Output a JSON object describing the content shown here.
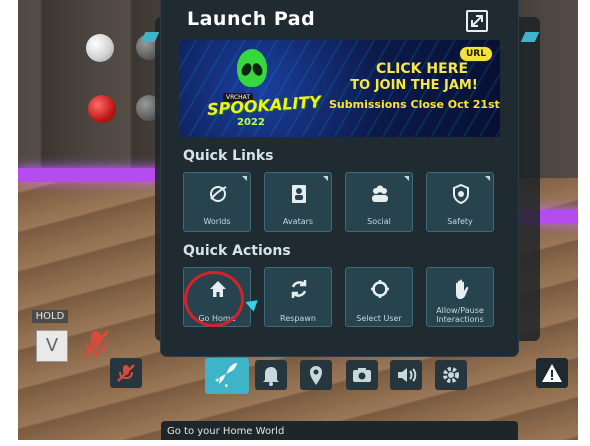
{
  "launch_pad": {
    "title": "Launch Pad"
  },
  "banner": {
    "brand_tag": "VRCHAT",
    "event_title": "SPOOKALITY",
    "event_year": "2022",
    "url_badge": "URL",
    "cta_line1": "CLICK HERE",
    "cta_line2": "TO JOIN THE JAM!",
    "deadline": "Submissions Close Oct 21st"
  },
  "quick_links": {
    "title": "Quick Links",
    "items": [
      {
        "label": "Worlds",
        "icon": "worlds-icon"
      },
      {
        "label": "Avatars",
        "icon": "avatars-icon"
      },
      {
        "label": "Social",
        "icon": "social-icon"
      },
      {
        "label": "Safety",
        "icon": "safety-icon"
      }
    ]
  },
  "quick_actions": {
    "title": "Quick Actions",
    "items": [
      {
        "label": "Go Home",
        "icon": "home-icon"
      },
      {
        "label": "Respawn",
        "icon": "respawn-icon"
      },
      {
        "label": "Select User",
        "icon": "crosshair-icon"
      },
      {
        "label": "Allow/Pause",
        "label2": "Interactions",
        "icon": "hand-icon"
      }
    ]
  },
  "hud": {
    "hold_label": "HOLD",
    "v_key": "V"
  },
  "status_bar": {
    "text": "Go to your Home World"
  },
  "colors": {
    "accent": "#3fb3c7",
    "panel_bg": "#1f2a31",
    "tile_bg": "#27434d",
    "highlight": "#d8202a",
    "neon": "#b44cf0"
  }
}
